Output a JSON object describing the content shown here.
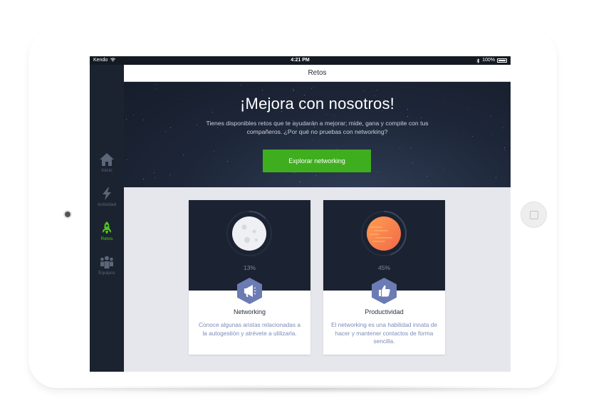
{
  "status_bar": {
    "carrier": "Kendo",
    "time": "4:21 PM",
    "battery": "100%"
  },
  "sidebar": {
    "items": [
      {
        "label": "Inicio",
        "icon": "home-icon",
        "active": false
      },
      {
        "label": "Actividad",
        "icon": "lightning-icon",
        "active": false
      },
      {
        "label": "Retos",
        "icon": "rocket-icon",
        "active": true
      },
      {
        "label": "Equipos",
        "icon": "team-icon",
        "active": false
      }
    ]
  },
  "navbar": {
    "title": "Retos"
  },
  "hero": {
    "title": "¡Mejora con nosotros!",
    "subtitle": "Tienes disponibles retos que te ayudarán a mejorar; mide, gana y compite con tus compañeros. ¿Por qué no pruebas con networking?",
    "cta_label": "Explorar networking"
  },
  "challenges": [
    {
      "title": "Networking",
      "percent": "13%",
      "progress": 0.13,
      "planet": "moon",
      "badge_icon": "megaphone-icon",
      "description": "Conoce algunas aristas relacionadas a la autogestión y atrévete a utilizarla."
    },
    {
      "title": "Productividad",
      "percent": "45%",
      "progress": 0.45,
      "planet": "sun",
      "badge_icon": "thumbs-up-icon",
      "description": "El networking es una habilidad innata de hacer y mantener contactos de forma sencilla."
    }
  ],
  "colors": {
    "accent": "#3fae1e",
    "active_nav": "#53c61c",
    "sidebar_bg": "#1b2330",
    "card_dark": "#1b2231",
    "badge": "#6b7bb3"
  }
}
